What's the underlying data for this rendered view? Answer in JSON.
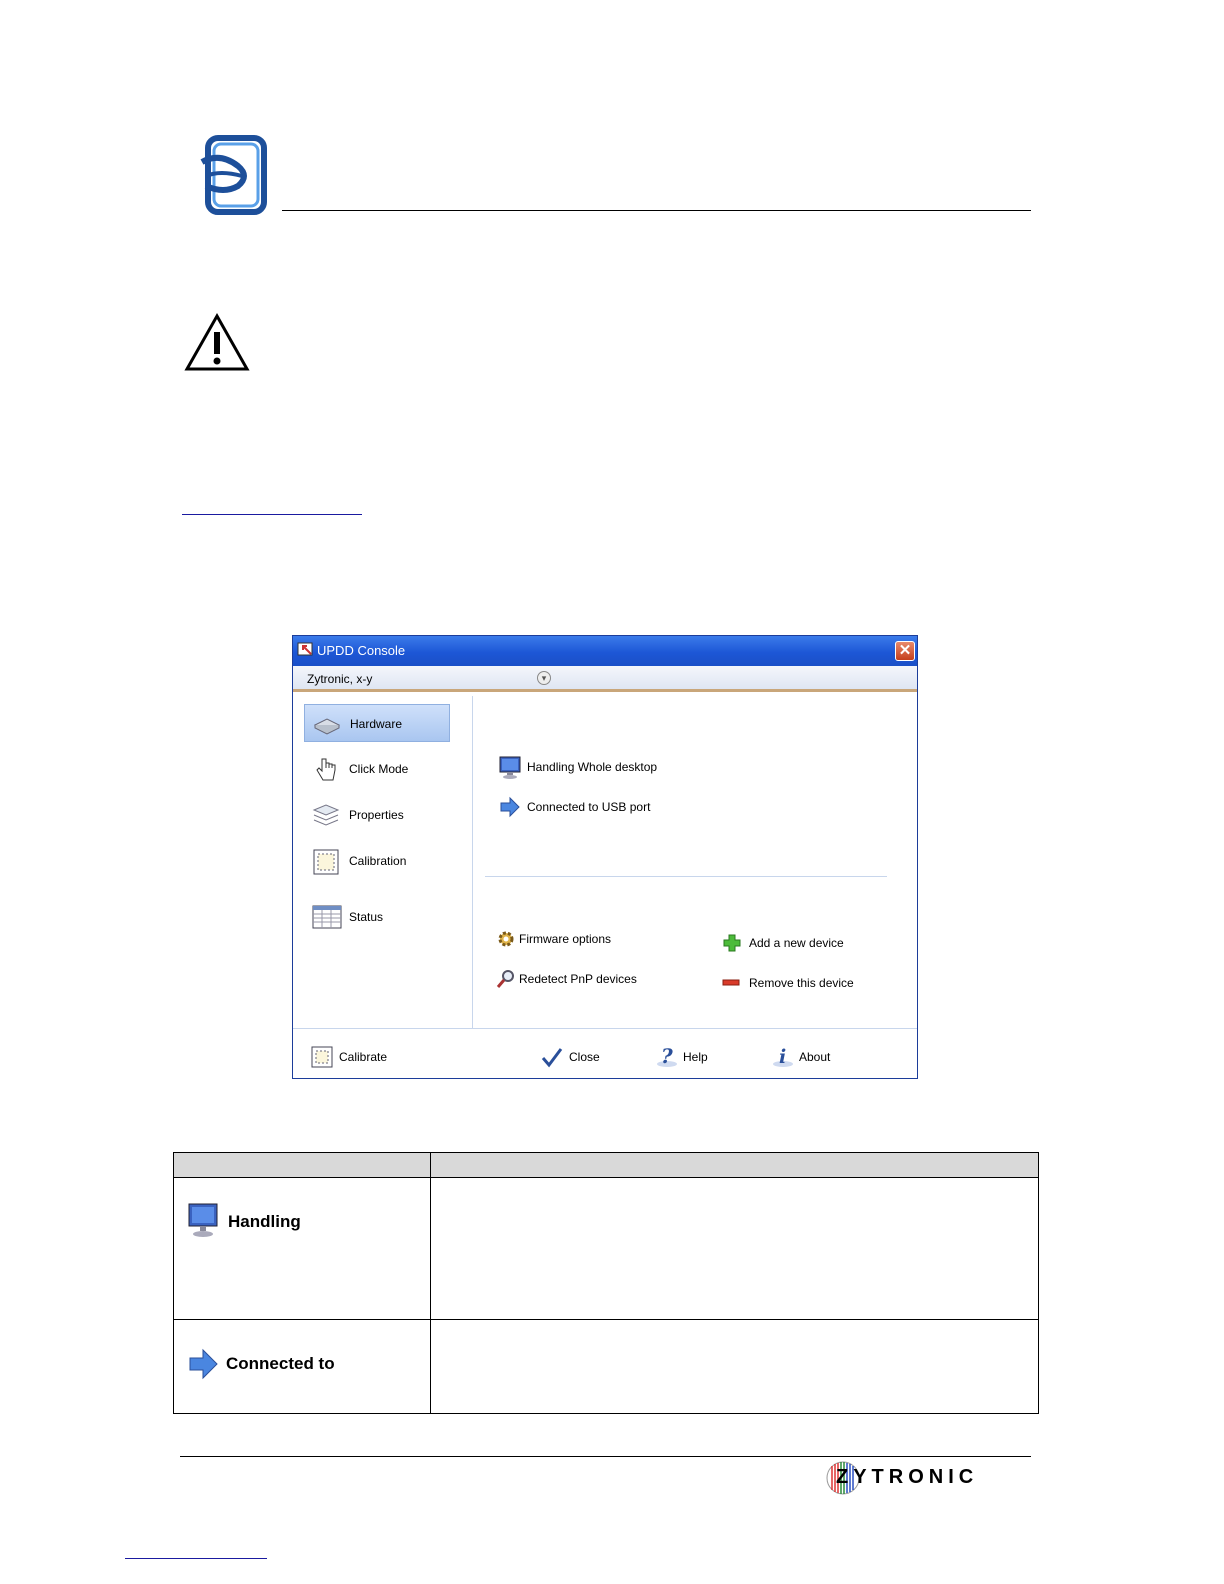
{
  "window": {
    "title": "UPDD Console",
    "close_glyph": "✕",
    "device": "Zytronic, x-y"
  },
  "nav": [
    {
      "label": "Hardware",
      "icon": "hardware-icon"
    },
    {
      "label": "Click Mode",
      "icon": "hand-pointer-icon"
    },
    {
      "label": "Properties",
      "icon": "layers-icon"
    },
    {
      "label": "Calibration",
      "icon": "calibration-icon"
    },
    {
      "label": "Status",
      "icon": "status-grid-icon"
    }
  ],
  "hardware_info": {
    "handling": "Handling Whole desktop",
    "connected": "Connected to USB port"
  },
  "actions": {
    "firmware": "Firmware options",
    "redetect": "Redetect PnP devices",
    "add": "Add a new device",
    "remove": "Remove this device"
  },
  "bottom_bar": {
    "calibrate": "Calibrate",
    "close": "Close",
    "help": "Help",
    "about": "About"
  },
  "table": {
    "rows": [
      {
        "label": "Handling",
        "icon": "monitor-icon"
      },
      {
        "label": "Connected to",
        "icon": "arrow-right-icon"
      }
    ]
  },
  "footer": {
    "brand": "ZYTRONIC"
  },
  "colors": {
    "titlebar": "#1d57d6",
    "accent": "#3b7bea"
  }
}
